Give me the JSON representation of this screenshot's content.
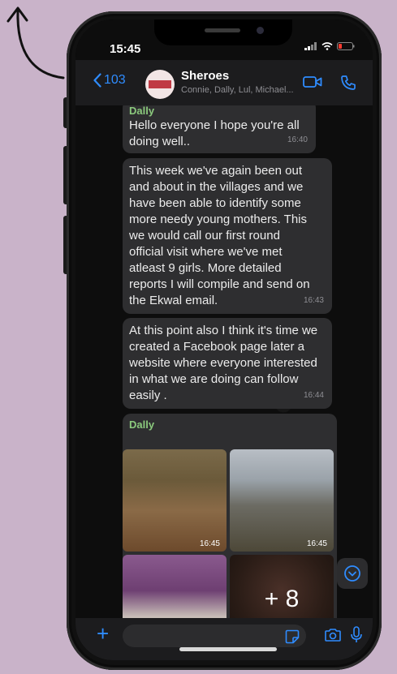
{
  "status_bar": {
    "time": "15:45"
  },
  "header": {
    "back_count": "103",
    "group_name": "Sheroes",
    "members": "Connie, Dally, Lul, Michael..."
  },
  "messages": [
    {
      "sender": "Dally",
      "text": "Hello everyone I hope you're all\ndoing well..",
      "time": "16:40"
    },
    {
      "sender": "",
      "text": "This week we've again been out\nand about in the villages and we\nhave been able to identify some\nmore needy young mothers. This\nwe would call our first round\nofficial visit where we've met\natleast 9 girls. More detailed\nreports I will compile and send on\nthe Ekwal email.",
      "time": "16:43"
    },
    {
      "sender": "",
      "text": "At this point also I think it's time we\ncreated a Facebook page later a\nwebsite where everyone interested\nin what we are doing can follow\neasily .",
      "time": "16:44"
    }
  ],
  "media_message": {
    "sender": "Dally",
    "photos": [
      {
        "time": "16:45"
      },
      {
        "time": "16:45"
      }
    ],
    "more_count": "+ 8"
  },
  "composer": {
    "placeholder": ""
  },
  "colors": {
    "accent": "#2f8cff",
    "sender": "#8bc97d",
    "bubble": "#2e2e30"
  }
}
